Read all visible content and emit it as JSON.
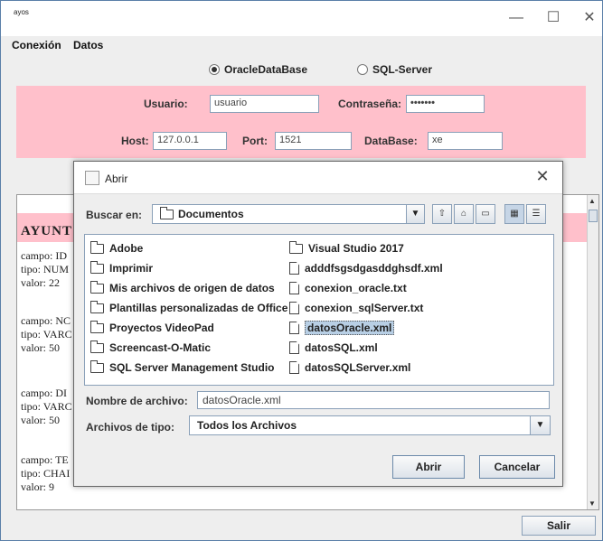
{
  "window": {
    "title": "ayos",
    "minimize": "—",
    "maximize": "☐",
    "close": "✕"
  },
  "menu": {
    "items": [
      "Conexión",
      "Datos"
    ]
  },
  "db_choice": {
    "oracle": "OracleDataBase",
    "sql": "SQL-Server",
    "selected": "OracleDataBase"
  },
  "connection": {
    "user_label": "Usuario:",
    "user_value": "usuario",
    "pass_label": "Contraseña:",
    "pass_value": "•••••••",
    "host_label": "Host:",
    "host_value": "127.0.0.1",
    "port_label": "Port:",
    "port_value": "1521",
    "db_label": "DataBase:",
    "db_value": "xe"
  },
  "output": {
    "heading": "AYUNT",
    "lines": [
      "campo: ID",
      "tipo: NUM",
      "valor: 22",
      "campo: NC",
      "tipo: VARC",
      "valor: 50",
      "campo: DI",
      "tipo: VARC",
      "valor: 50",
      "campo: TE",
      "tipo: CHAI",
      "valor: 9"
    ]
  },
  "salir_label": "Salir",
  "dialog": {
    "title": "Abrir",
    "close": "✕",
    "look_in_label": "Buscar en:",
    "look_in_value": "Documentos",
    "toolbar_icons": [
      "up-folder-icon",
      "home-icon",
      "new-folder-icon",
      "list-view-icon",
      "details-view-icon"
    ],
    "files_col1": [
      {
        "name": "Adobe",
        "type": "folder"
      },
      {
        "name": "Imprimir",
        "type": "folder"
      },
      {
        "name": "Mis archivos de origen de datos",
        "type": "folder"
      },
      {
        "name": "Plantillas personalizadas de Office",
        "type": "folder"
      },
      {
        "name": "Proyectos VideoPad",
        "type": "folder"
      },
      {
        "name": "Screencast-O-Matic",
        "type": "folder"
      },
      {
        "name": "SQL Server Management Studio",
        "type": "folder"
      }
    ],
    "files_col2": [
      {
        "name": "Visual Studio 2017",
        "type": "folder"
      },
      {
        "name": "adddfsgsdgasddghsdf.xml",
        "type": "file"
      },
      {
        "name": "conexion_oracle.txt",
        "type": "file"
      },
      {
        "name": "conexion_sqlServer.txt",
        "type": "file"
      },
      {
        "name": "datosOracle.xml",
        "type": "file",
        "selected": true
      },
      {
        "name": "datosSQL.xml",
        "type": "file"
      },
      {
        "name": "datosSQLServer.xml",
        "type": "file"
      }
    ],
    "filename_label": "Nombre de archivo:",
    "filename_value": "datosOracle.xml",
    "filetype_label": "Archivos de tipo:",
    "filetype_value": "Todos los Archivos",
    "open_label": "Abrir",
    "cancel_label": "Cancelar"
  }
}
